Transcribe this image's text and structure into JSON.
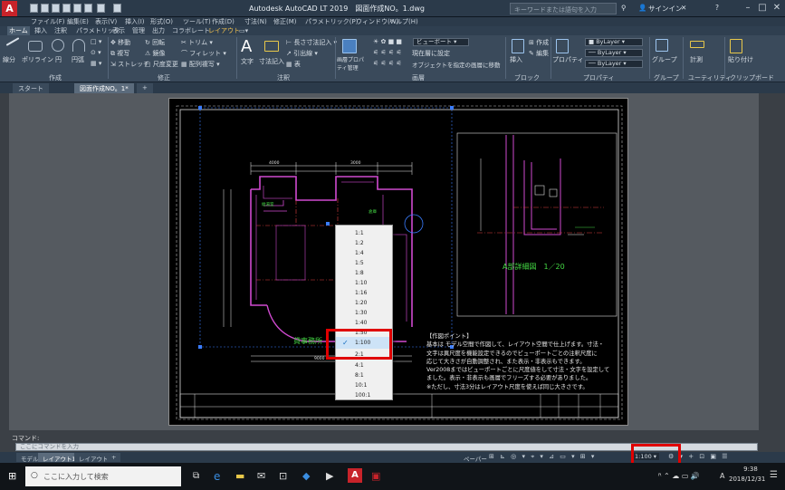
{
  "titlebar": {
    "title": "Autodesk AutoCAD LT 2019　図面作成NO。1.dwg",
    "search_placeholder": "キーワードまたは語句を入力",
    "signin": "サインイン"
  },
  "menubar": [
    "ファイル(F)",
    "編集(E)",
    "表示(V)",
    "挿入(I)",
    "形式(O)",
    "ツール(T)",
    "作成(D)",
    "寸法(N)",
    "修正(M)",
    "パラメトリック(P)",
    "ウィンドウ(W)",
    "ヘルプ(H)"
  ],
  "ribbon_tabs": [
    "ホーム",
    "挿入",
    "注釈",
    "パラメトリック",
    "表示",
    "管理",
    "出力",
    "コラボレート",
    "レイアウト"
  ],
  "ribbon": {
    "line": "線分",
    "polyline": "ポリライン",
    "circle": "円",
    "arc": "円弧",
    "move": "移動",
    "copy": "複写",
    "stretch": "ストレッチ",
    "rotate": "回転",
    "mirror": "鏡像",
    "scale": "尺度変更",
    "trim": "トリム",
    "fillet": "フィレット",
    "array": "配列複写",
    "text": "文字",
    "dimension": "寸法記入",
    "linear": "長さ寸法記入",
    "leader": "引出線",
    "table": "表",
    "layer_props": "画層プロパティ管理",
    "viewport": "ビューポート",
    "set_current": "現在層に設定",
    "match_layer": "オブジェクトを指定の画層に移動",
    "insert": "挿入",
    "create": "作成",
    "edit": "編集",
    "properties": "プロパティ",
    "group": "グループ",
    "measure": "計測",
    "paste": "貼り付け",
    "bylayer": "ByLayer",
    "groups": [
      "作成",
      "修正",
      "注釈",
      "画層",
      "ブロック",
      "プロパティ",
      "グループ",
      "ユーティリティ",
      "クリップボード"
    ]
  },
  "doc_tabs": [
    "スタート",
    "図面作成NO。1*",
    "+"
  ],
  "drawing": {
    "room_label": "貸事務所",
    "detail_label": "A部詳細図　1／20",
    "notes": [
      "【作図ポイント】",
      "基本は モデル空間で作図して、レイアウト空間で仕上げます。寸法・",
      "文字は異尺度を機能設定できるのでビューポートごとの注釈尺度に",
      "応じて大きさが自動調整され、また表示・非表示もできます。",
      "Ver2008まではビューポートごとに尺度値をして寸法・文字を設定して",
      "ました。表示・非表示も画層でフリーズする必要がありました。",
      "※ただし、寸法3分はレイアウト尺度を使えば同じ大きさです。"
    ]
  },
  "scale_menu": {
    "items": [
      "1:1",
      "1:2",
      "1:4",
      "1:5",
      "1:8",
      "1:10",
      "1:16",
      "1:20",
      "1:30",
      "1:40",
      "1:50",
      "1:100",
      "2:1",
      "4:1",
      "8:1",
      "10:1",
      "100:1"
    ],
    "selected": "1:100"
  },
  "command": {
    "label": "コマンド:",
    "placeholder": "ここにコマンドを入力"
  },
  "layout_tabs": [
    "モデル",
    "レイアウト1",
    "レイアウト2",
    "+"
  ],
  "status": {
    "paper": "ペーパー",
    "scale": "1:100"
  },
  "taskbar": {
    "search": "ここに入力して検索",
    "time": "9:38",
    "date": "2018/12/31",
    "lang": "A"
  },
  "colors": {
    "accent_red": "#e00000",
    "titlebar": "#2b3a4a",
    "paper": "#000000"
  }
}
